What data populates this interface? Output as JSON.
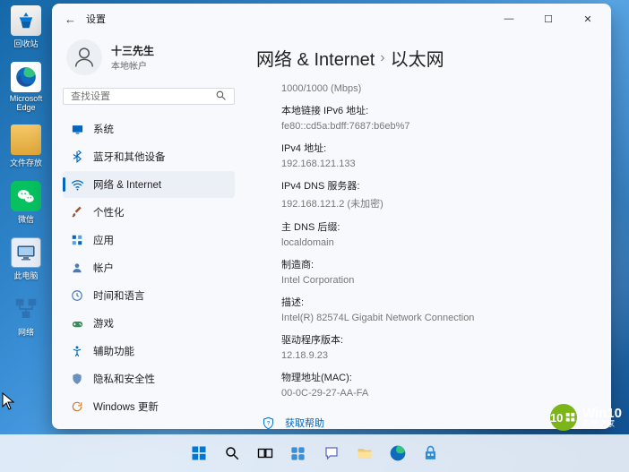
{
  "desktop": {
    "icons": [
      {
        "label": "回收站",
        "id": "recycle-bin"
      },
      {
        "label": "Microsoft Edge",
        "id": "edge"
      },
      {
        "label": "文件存放",
        "id": "files"
      },
      {
        "label": "微信",
        "id": "wechat"
      },
      {
        "label": "此电脑",
        "id": "this-pc"
      },
      {
        "label": "网络",
        "id": "network"
      }
    ]
  },
  "window": {
    "title": "设置",
    "account": {
      "name": "十三先生",
      "type": "本地帐户"
    },
    "search_placeholder": "查找设置",
    "nav": [
      {
        "label": "系统"
      },
      {
        "label": "蓝牙和其他设备"
      },
      {
        "label": "网络 & Internet"
      },
      {
        "label": "个性化"
      },
      {
        "label": "应用"
      },
      {
        "label": "帐户"
      },
      {
        "label": "时间和语言"
      },
      {
        "label": "游戏"
      },
      {
        "label": "辅助功能"
      },
      {
        "label": "隐私和安全性"
      },
      {
        "label": "Windows 更新"
      }
    ],
    "breadcrumb": {
      "root": "网络 & Internet",
      "leaf": "以太网"
    },
    "details": {
      "speed": "1000/1000 (Mbps)",
      "ipv6_label": "本地链接 IPv6 地址:",
      "ipv6": "fe80::cd5a:bdff:7687:b6eb%7",
      "ipv4_label": "IPv4 地址:",
      "ipv4": "192.168.121.133",
      "dns_label": "IPv4 DNS 服务器:",
      "dns": "192.168.121.2 (未加密)",
      "dns_suffix_label": "主 DNS 后缀:",
      "dns_suffix": "localdomain",
      "mfr_label": "制造商:",
      "mfr": "Intel Corporation",
      "desc_label": "描述:",
      "desc": "Intel(R) 82574L Gigabit Network Connection",
      "drv_label": "驱动程序版本:",
      "drv": "12.18.9.23",
      "mac_label": "物理地址(MAC):",
      "mac": "00-0C-29-27-AA-FA"
    },
    "help": "获取帮助"
  },
  "watermark": {
    "badge": "10",
    "line1": "Win10",
    "line2": "系统之家"
  },
  "colors": {
    "accent": "#0067c0"
  }
}
